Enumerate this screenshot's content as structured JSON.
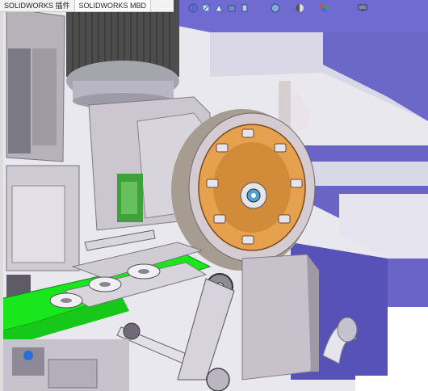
{
  "tabs": [
    {
      "label": "SOLIDWORKS 插件"
    },
    {
      "label": "SOLIDWORKS MBD"
    }
  ],
  "hud_icons": [
    {
      "icon": "view-orientation-icon"
    },
    {
      "icon": "section-view-icon"
    },
    {
      "icon": "dynamic-annotation-icon"
    },
    {
      "icon": "display-style-icon"
    },
    {
      "icon": "hide-show-items-icon"
    },
    {
      "icon": "edit-appearance-icon"
    },
    {
      "icon": "apply-scene-icon"
    },
    {
      "icon": "view-settings-icon"
    },
    {
      "icon": "monitor-icon"
    }
  ],
  "colors": {
    "frame_purple": "#6f6bd0",
    "frame_light": "#e4e4ec",
    "machine_grey": "#c9c5cd",
    "conveyor_green": "#19e61c",
    "disc_orange": "#e8a24f",
    "motor_dark": "#4a4a4a"
  }
}
